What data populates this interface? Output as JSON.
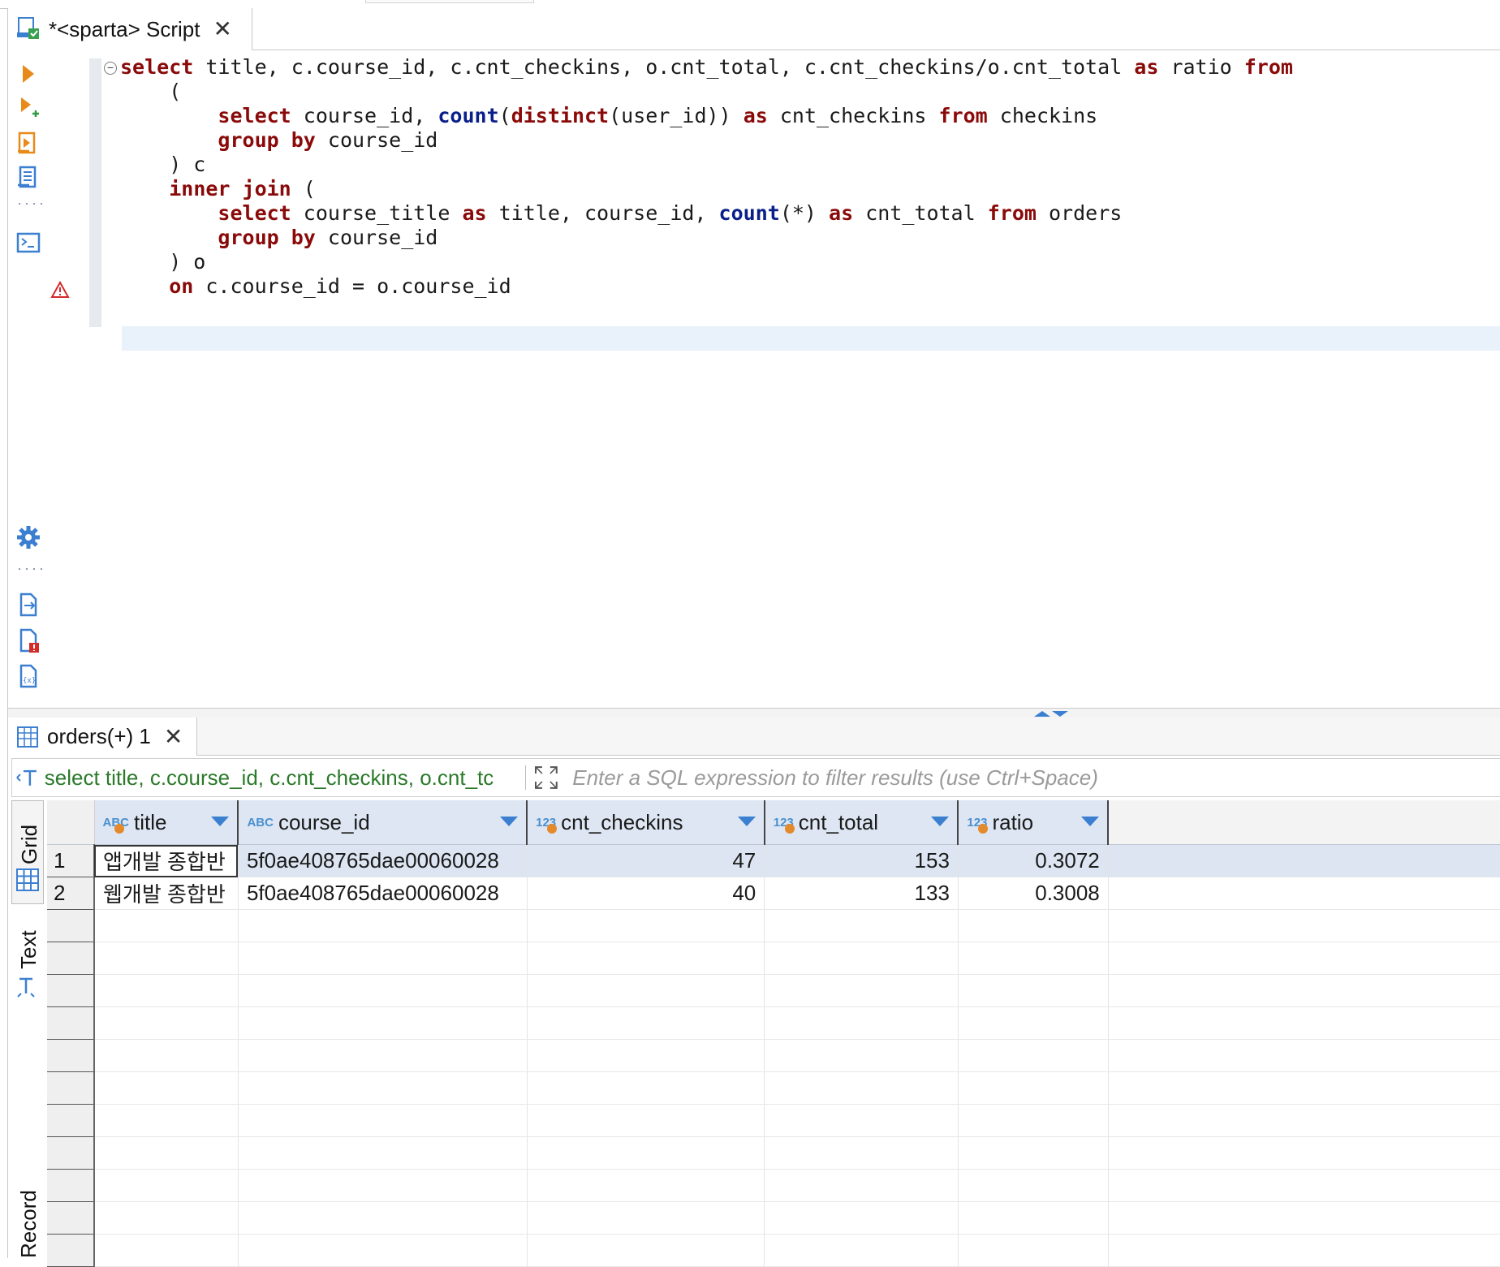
{
  "editor": {
    "tab_title": "*<sparta> Script",
    "code_lines": [
      [
        [
          "kw",
          "select"
        ],
        [
          "t",
          " title, c.course_id, c.cnt_checkins, o.cnt_total, c.cnt_checkins/o.cnt_total "
        ],
        [
          "kw",
          "as"
        ],
        [
          "t",
          " ratio "
        ],
        [
          "kw",
          "from"
        ]
      ],
      [
        [
          "t",
          "    ("
        ]
      ],
      [
        [
          "t",
          "        "
        ],
        [
          "kw",
          "select"
        ],
        [
          "t",
          " course_id, "
        ],
        [
          "fn",
          "count"
        ],
        [
          "t",
          "("
        ],
        [
          "kw",
          "distinct"
        ],
        [
          "t",
          "(user_id)) "
        ],
        [
          "kw",
          "as"
        ],
        [
          "t",
          " cnt_checkins "
        ],
        [
          "kw",
          "from"
        ],
        [
          "t",
          " checkins"
        ]
      ],
      [
        [
          "t",
          "        "
        ],
        [
          "kw",
          "group by"
        ],
        [
          "t",
          " course_id"
        ]
      ],
      [
        [
          "t",
          "    ) c"
        ]
      ],
      [
        [
          "t",
          "    "
        ],
        [
          "kw",
          "inner join"
        ],
        [
          "t",
          " ("
        ]
      ],
      [
        [
          "t",
          "        "
        ],
        [
          "kw",
          "select"
        ],
        [
          "t",
          " course_title "
        ],
        [
          "kw",
          "as"
        ],
        [
          "t",
          " title, course_id, "
        ],
        [
          "fn",
          "count"
        ],
        [
          "t",
          "(*) "
        ],
        [
          "kw",
          "as"
        ],
        [
          "t",
          " cnt_total "
        ],
        [
          "kw",
          "from"
        ],
        [
          "t",
          " orders"
        ]
      ],
      [
        [
          "t",
          "        "
        ],
        [
          "kw",
          "group by"
        ],
        [
          "t",
          " course_id"
        ]
      ],
      [
        [
          "t",
          "    ) o"
        ]
      ],
      [
        [
          "t",
          "    "
        ],
        [
          "kw",
          "on"
        ],
        [
          "t",
          " c.course_id = o.course_id"
        ]
      ]
    ]
  },
  "results": {
    "tab_title": "orders(+) 1",
    "query_preview": "select title, c.course_id, c.cnt_checkins, o.cnt_tc",
    "filter_placeholder": "Enter a SQL expression to filter results (use Ctrl+Space)",
    "view_tabs": {
      "grid": "Grid",
      "text": "Text",
      "record": "Record"
    },
    "columns": [
      {
        "type": "ABC",
        "name": "title"
      },
      {
        "type": "ABC",
        "name": "course_id"
      },
      {
        "type": "123",
        "name": "cnt_checkins"
      },
      {
        "type": "123",
        "name": "cnt_total"
      },
      {
        "type": "123",
        "name": "ratio"
      }
    ],
    "rows": [
      {
        "num": "1",
        "title": "앱개발 종합반",
        "course_id": "5f0ae408765dae00060028",
        "cnt_checkins": "47",
        "cnt_total": "153",
        "ratio": "0.3072"
      },
      {
        "num": "2",
        "title": "웹개발 종합반",
        "course_id": "5f0ae408765dae00060028",
        "cnt_checkins": "40",
        "cnt_total": "133",
        "ratio": "0.3008"
      }
    ]
  },
  "colors": {
    "keyword": "#8a0a0a",
    "function": "#0a1f8a",
    "accent": "#3a7fd0",
    "query_text": "#2a7a2a"
  }
}
